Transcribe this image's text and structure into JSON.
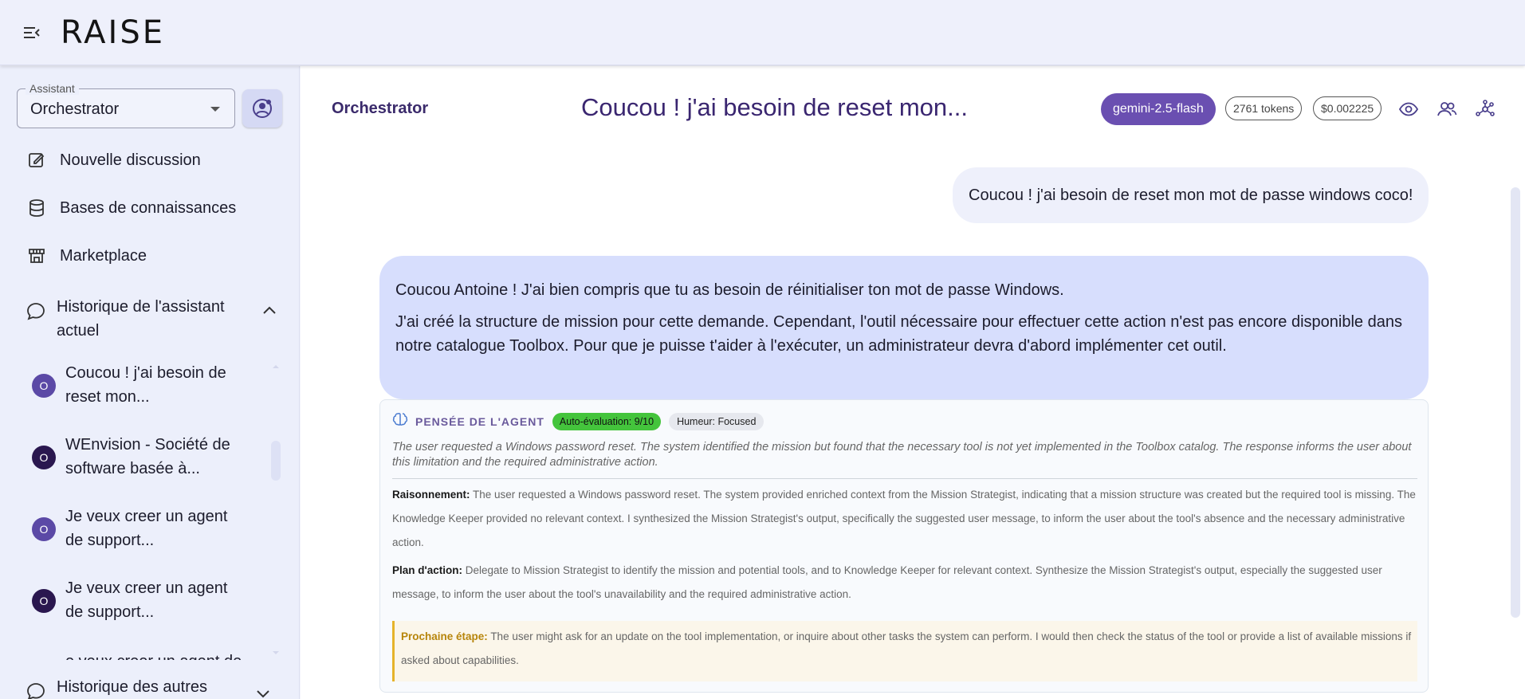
{
  "app": {
    "logo": "RAISE"
  },
  "sidebar": {
    "assistant_select": {
      "label": "Assistant",
      "value": "Orchestrator"
    },
    "nav": [
      {
        "label": "Nouvelle discussion",
        "icon": "edit-icon"
      },
      {
        "label": "Bases de connaissances",
        "icon": "database-icon"
      },
      {
        "label": "Marketplace",
        "icon": "store-icon"
      }
    ],
    "current_history": {
      "label": "Historique de l'assistant actuel",
      "icon": "chat-bubble-icon",
      "expanded": true
    },
    "history_items": [
      {
        "avatar": "O",
        "avatar_color": "#5b49a6",
        "text": "Coucou ! j'ai besoin de reset mon..."
      },
      {
        "avatar": "O",
        "avatar_color": "#2a174f",
        "text": "WEnvision - Société de software basée à..."
      },
      {
        "avatar": "O",
        "avatar_color": "#5b49a6",
        "text": "Je veux creer un agent de support..."
      },
      {
        "avatar": "O",
        "avatar_color": "#2a174f",
        "text": "Je veux creer un agent de support..."
      },
      {
        "avatar": "O",
        "avatar_color": "#5b49a6",
        "text": "e veux creer un agent de"
      }
    ],
    "other_history": {
      "label": "Historique des autres"
    }
  },
  "conversation": {
    "assistant_name": "Orchestrator",
    "title": "Coucou ! j'ai besoin de reset mon...",
    "model": "gemini-2.5-flash",
    "tokens": "2761 tokens",
    "cost": "$0.002225",
    "user_message": "Coucou ! j'ai besoin de reset mon mot de passe windows coco!",
    "assistant_message": [
      "Coucou Antoine ! J'ai bien compris que tu as besoin de réinitialiser ton mot de passe Windows.",
      "J'ai créé la structure de mission pour cette demande. Cependant, l'outil nécessaire pour effectuer cette action n'est pas encore disponible dans notre catalogue Toolbox. Pour que je puisse t'aider à l'exécuter, un administrateur devra d'abord implémenter cet outil."
    ],
    "thought": {
      "title": "PENSÉE DE L'AGENT",
      "self_eval": "Auto-évaluation: 9/10",
      "mood": "Humeur: Focused",
      "summary": "The user requested a Windows password reset. The system identified the mission but found that the necessary tool is not yet implemented in the Toolbox catalog. The response informs the user about this limitation and the required administrative action.",
      "reasoning_label": "Raisonnement:",
      "reasoning": "The user requested a Windows password reset. The system provided enriched context from the Mission Strategist, indicating that a mission structure was created but the required tool is missing. The Knowledge Keeper provided no relevant context. I synthesized the Mission Strategist's output, specifically the suggested user message, to inform the user about the tool's absence and the necessary administrative action.",
      "plan_label": "Plan d'action:",
      "plan": "Delegate to Mission Strategist to identify the mission and potential tools, and to Knowledge Keeper for relevant context. Synthesize the Mission Strategist's output, especially the suggested user message, to inform the user about the tool's unavailability and the required administrative action.",
      "next_label": "Prochaine étape:",
      "next": "The user might ask for an update on the tool implementation, or inquire about other tasks the system can perform. I would then check the status of the tool or provide a list of available missions if asked about capabilities."
    }
  },
  "colors": {
    "accent": "#6a4fb1",
    "user_bubble": "#eef0fb",
    "assistant_bubble": "#d7defd",
    "badge_green": "#44c43c",
    "next_step_border": "#e6b32a"
  }
}
